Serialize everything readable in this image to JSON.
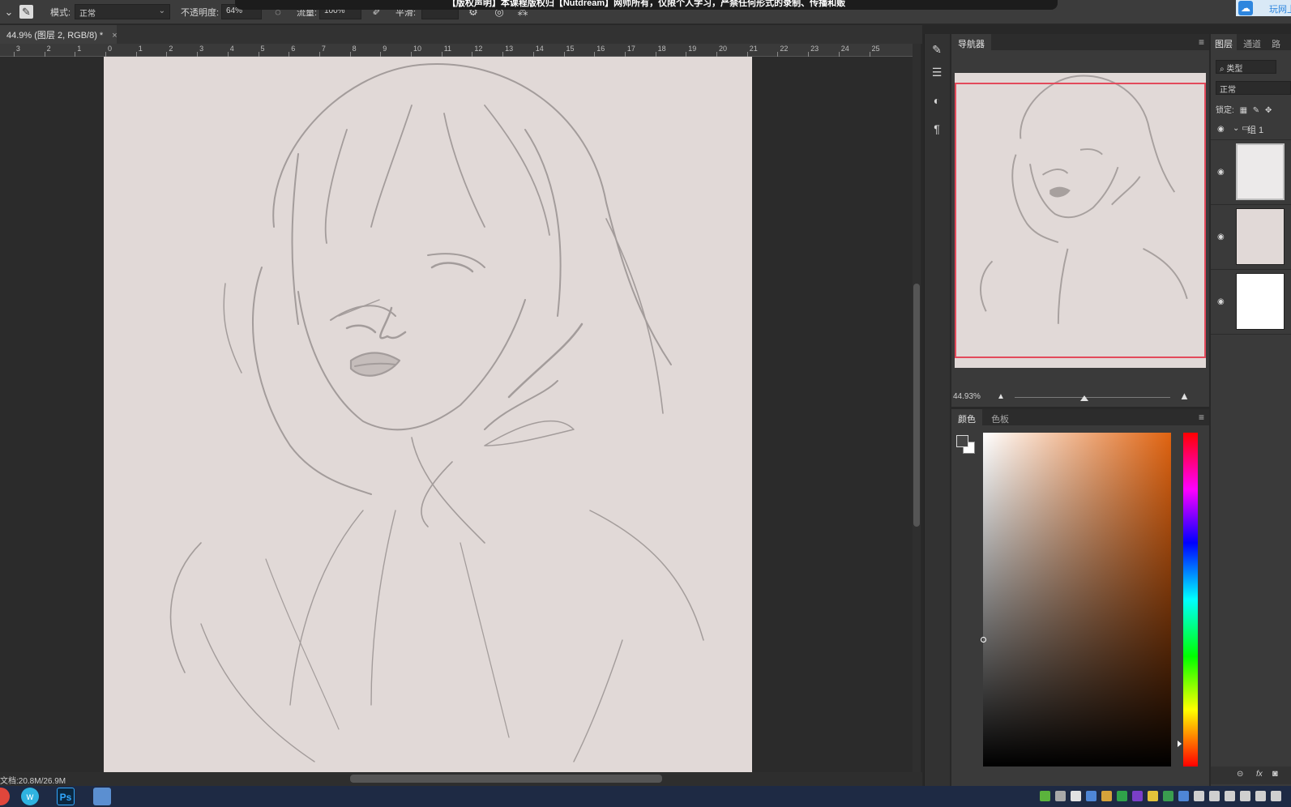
{
  "options_bar": {
    "mode_label": "模式:",
    "mode_value": "正常",
    "opacity_label": "不透明度:",
    "opacity_value": "64%",
    "flow_label": "流量:",
    "flow_value": "100%",
    "smoothing_label": "平滑:"
  },
  "banner_text": "【版权声明】本课程版权归【Nutdream】网师所有，仅限个人学习，严禁任何形式的录制、传播和贩",
  "cloud_badge": {
    "label": "玩网上"
  },
  "document": {
    "tab_title": "44.9% (图层 2, RGB/8) *",
    "close_glyph": "×",
    "status_doc_size": "文档:20.8M/26.9M"
  },
  "ruler_labels": [
    "3",
    "2",
    "1",
    "0",
    "1",
    "2",
    "3",
    "4",
    "5",
    "6",
    "7",
    "8",
    "9",
    "10",
    "11",
    "12",
    "13",
    "14",
    "15",
    "16",
    "17",
    "18",
    "19",
    "20",
    "21",
    "22",
    "23",
    "24",
    "25"
  ],
  "navigator": {
    "tab_label": "导航器",
    "zoom_value": "44.93%",
    "zoom_fraction": 0.45
  },
  "color_panel": {
    "tabs": [
      "颜色",
      "色板"
    ],
    "foreground_color": "#454545",
    "background_color": "#ffffff",
    "field_hue_color": "#e06310"
  },
  "layers_panel": {
    "tabs": [
      "图层",
      "通道",
      "路"
    ],
    "filter_label": "类型",
    "blend_mode": "正常",
    "lock_label": "锁定:",
    "group_name": "组 1",
    "layers": [
      {
        "kind": "group",
        "visible": true
      },
      {
        "kind": "sketch",
        "visible": true
      },
      {
        "kind": "paper",
        "visible": true
      },
      {
        "kind": "white",
        "visible": true
      }
    ]
  },
  "taskbar": {
    "apps": [
      {
        "icon": "browser-icon",
        "color": "#e0463b"
      },
      {
        "icon": "w-app-icon",
        "glyph": "w",
        "color": "#2fb3e0"
      },
      {
        "icon": "photoshop-icon",
        "glyph": "Ps",
        "color": "#0b2740"
      },
      {
        "icon": "recycle-icon",
        "color": "#5b8fd1"
      }
    ],
    "tray_colors": [
      "#5bb33c",
      "#a8a8a8",
      "#e2e2e2",
      "#4e86d6",
      "#d6a33a",
      "#2fa34a",
      "#7a3fc8",
      "#e2c33a",
      "#3a9e4f",
      "#4e86d6",
      "#cfcfcf",
      "#cfcfcf",
      "#cfcfcf",
      "#cfcfcf",
      "#cfcfcf",
      "#cfcfcf"
    ]
  },
  "colors": {
    "canvas": "#e1d9d7",
    "accent_view_box": "#e34a5b",
    "taskbar": "#1e2a44"
  }
}
